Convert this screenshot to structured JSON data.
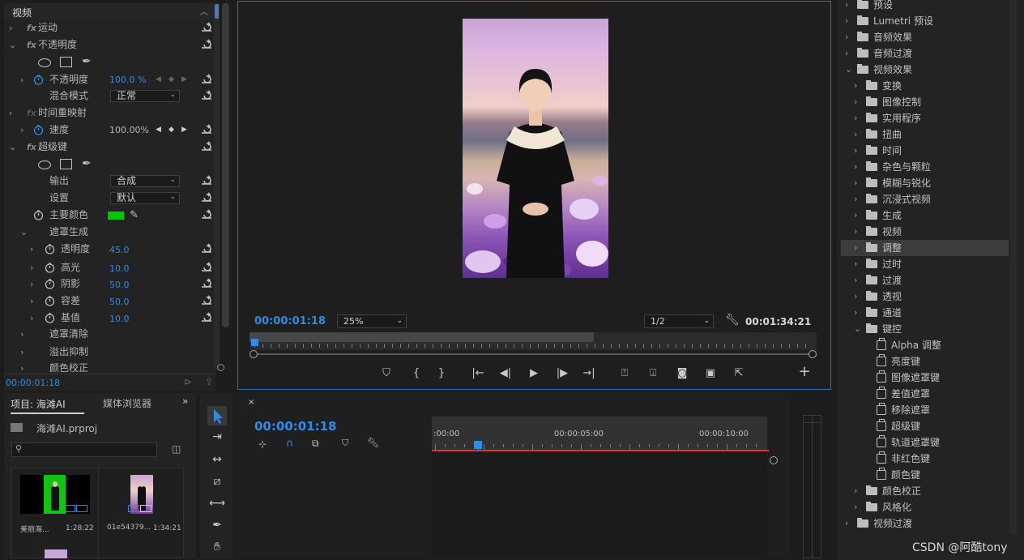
{
  "effect_controls": {
    "section_title": "视频",
    "rows": [
      {
        "type": "fx",
        "label": "运动"
      },
      {
        "type": "fx",
        "label": "不透明度"
      },
      {
        "type": "masks"
      },
      {
        "type": "param",
        "label": "不透明度",
        "value": "100.0 %"
      },
      {
        "type": "select",
        "label": "混合模式",
        "value": "正常"
      },
      {
        "type": "fx",
        "label": "时间重映射"
      },
      {
        "type": "param",
        "label": "速度",
        "value": "100.00%"
      },
      {
        "type": "fx",
        "label": "超级键"
      },
      {
        "type": "masks"
      },
      {
        "type": "select",
        "label": "输出",
        "value": "合成"
      },
      {
        "type": "select",
        "label": "设置",
        "value": "默认"
      },
      {
        "type": "color",
        "label": "主要颜色",
        "color": "#00c800"
      },
      {
        "type": "group",
        "label": "遮罩生成"
      },
      {
        "type": "param",
        "label": "透明度",
        "value": "45.0"
      },
      {
        "type": "param",
        "label": "高光",
        "value": "10.0"
      },
      {
        "type": "param",
        "label": "阴影",
        "value": "50.0"
      },
      {
        "type": "param",
        "label": "容差",
        "value": "50.0"
      },
      {
        "type": "param",
        "label": "基值",
        "value": "10.0"
      },
      {
        "type": "group",
        "label": "遮罩清除"
      },
      {
        "type": "group",
        "label": "溢出抑制"
      },
      {
        "type": "group",
        "label": "颜色校正"
      }
    ],
    "timecode": "00:00:01:18"
  },
  "program_monitor": {
    "timecode": "00:00:01:18",
    "zoom": "25%",
    "resolution": "1/2",
    "duration": "00:01:34:21"
  },
  "project": {
    "tabs": [
      "项目: 海滩AI",
      "媒体浏览器"
    ],
    "project_file": "海滩AI.prproj",
    "search_placeholder": "",
    "clips": [
      {
        "name": "美丽海...",
        "duration": "1:28:22"
      },
      {
        "name": "01e54379...",
        "duration": "1:34:21"
      }
    ]
  },
  "timeline": {
    "timecode": "00:00:01:18",
    "ruler_labels": [
      ":00:00",
      "00:00:05:00",
      "00:00:10:00"
    ]
  },
  "effects": {
    "rows": [
      {
        "level": 0,
        "icon": "preset",
        "label": "预设",
        "open": false
      },
      {
        "level": 0,
        "icon": "preset",
        "label": "Lumetri 预设",
        "open": false
      },
      {
        "level": 0,
        "icon": "folder",
        "label": "音频效果",
        "open": false
      },
      {
        "level": 0,
        "icon": "folder",
        "label": "音频过渡",
        "open": false
      },
      {
        "level": 0,
        "icon": "folder",
        "label": "视频效果",
        "open": true
      },
      {
        "level": 1,
        "icon": "folder",
        "label": "变换",
        "open": false
      },
      {
        "level": 1,
        "icon": "folder",
        "label": "图像控制",
        "open": false
      },
      {
        "level": 1,
        "icon": "folder",
        "label": "实用程序",
        "open": false
      },
      {
        "level": 1,
        "icon": "folder",
        "label": "扭曲",
        "open": false
      },
      {
        "level": 1,
        "icon": "folder",
        "label": "时间",
        "open": false
      },
      {
        "level": 1,
        "icon": "folder",
        "label": "杂色与颗粒",
        "open": false
      },
      {
        "level": 1,
        "icon": "folder",
        "label": "模糊与锐化",
        "open": false
      },
      {
        "level": 1,
        "icon": "folder",
        "label": "沉浸式视频",
        "open": false
      },
      {
        "level": 1,
        "icon": "folder",
        "label": "生成",
        "open": false
      },
      {
        "level": 1,
        "icon": "folder",
        "label": "视频",
        "open": false
      },
      {
        "level": 1,
        "icon": "folder",
        "label": "调整",
        "open": false,
        "selected": true
      },
      {
        "level": 1,
        "icon": "folder",
        "label": "过时",
        "open": false
      },
      {
        "level": 1,
        "icon": "folder",
        "label": "过渡",
        "open": false
      },
      {
        "level": 1,
        "icon": "folder",
        "label": "透视",
        "open": false
      },
      {
        "level": 1,
        "icon": "folder",
        "label": "通道",
        "open": false
      },
      {
        "level": 1,
        "icon": "folder",
        "label": "键控",
        "open": true
      },
      {
        "level": 2,
        "icon": "effect",
        "label": "Alpha 调整"
      },
      {
        "level": 2,
        "icon": "effect",
        "label": "亮度键"
      },
      {
        "level": 2,
        "icon": "effect",
        "label": "图像遮罩键"
      },
      {
        "level": 2,
        "icon": "effect",
        "label": "差值遮罩"
      },
      {
        "level": 2,
        "icon": "effect",
        "label": "移除遮罩"
      },
      {
        "level": 2,
        "icon": "effect",
        "label": "超级键"
      },
      {
        "level": 2,
        "icon": "effect",
        "label": "轨道遮罩键"
      },
      {
        "level": 2,
        "icon": "effect",
        "label": "非红色键"
      },
      {
        "level": 2,
        "icon": "effect",
        "label": "颜色键"
      },
      {
        "level": 1,
        "icon": "folder",
        "label": "颜色校正",
        "open": false
      },
      {
        "level": 1,
        "icon": "folder",
        "label": "风格化",
        "open": false
      },
      {
        "level": 0,
        "icon": "folder",
        "label": "视频过渡",
        "open": false
      }
    ]
  },
  "watermark": "CSDN @阿酷tony"
}
